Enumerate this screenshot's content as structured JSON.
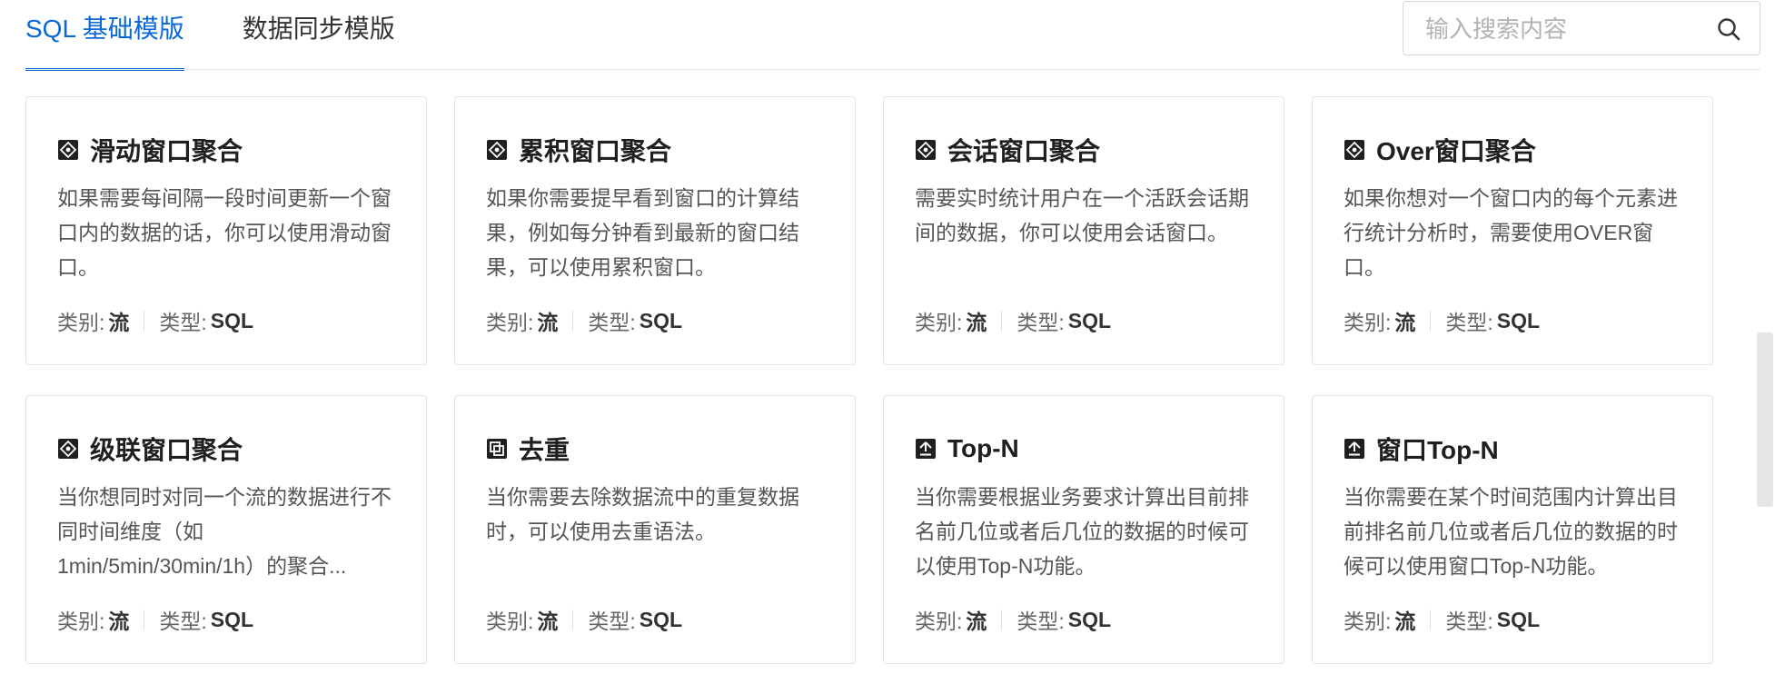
{
  "tabs": [
    {
      "label": "SQL 基础模版",
      "active": true
    },
    {
      "label": "数据同步模版",
      "active": false
    }
  ],
  "search": {
    "placeholder": "输入搜索内容",
    "icon": "search-icon"
  },
  "labels": {
    "category": "类别:",
    "type": "类型:"
  },
  "cards": [
    {
      "title": "滑动窗口聚合",
      "icon": "window-icon",
      "desc": "如果需要每间隔一段时间更新一个窗口内的数据的话，你可以使用滑动窗口。",
      "category": "流",
      "type": "SQL"
    },
    {
      "title": "累积窗口聚合",
      "icon": "window-icon",
      "desc": "如果你需要提早看到窗口的计算结果，例如每分钟看到最新的窗口结果，可以使用累积窗口。",
      "category": "流",
      "type": "SQL"
    },
    {
      "title": "会话窗口聚合",
      "icon": "window-icon",
      "desc": "需要实时统计用户在一个活跃会话期间的数据，你可以使用会话窗口。",
      "category": "流",
      "type": "SQL"
    },
    {
      "title": "Over窗口聚合",
      "icon": "window-icon",
      "desc": "如果你想对一个窗口内的每个元素进行统计分析时，需要使用OVER窗口。",
      "category": "流",
      "type": "SQL"
    },
    {
      "title": "级联窗口聚合",
      "icon": "window-icon",
      "desc": "当你想同时对同一个流的数据进行不同时间维度（如1min/5min/30min/1h）的聚合...",
      "category": "流",
      "type": "SQL"
    },
    {
      "title": "去重",
      "icon": "dedup-icon",
      "desc": "当你需要去除数据流中的重复数据时，可以使用去重语法。",
      "category": "流",
      "type": "SQL"
    },
    {
      "title": "Top-N",
      "icon": "top-n-icon",
      "desc": "当你需要根据业务要求计算出目前排名前几位或者后几位的数据的时候可以使用Top-N功能。",
      "category": "流",
      "type": "SQL"
    },
    {
      "title": "窗口Top-N",
      "icon": "top-n-icon",
      "desc": "当你需要在某个时间范围内计算出目前排名前几位或者后几位的数据的时候可以使用窗口Top-N功能。",
      "category": "流",
      "type": "SQL"
    }
  ]
}
